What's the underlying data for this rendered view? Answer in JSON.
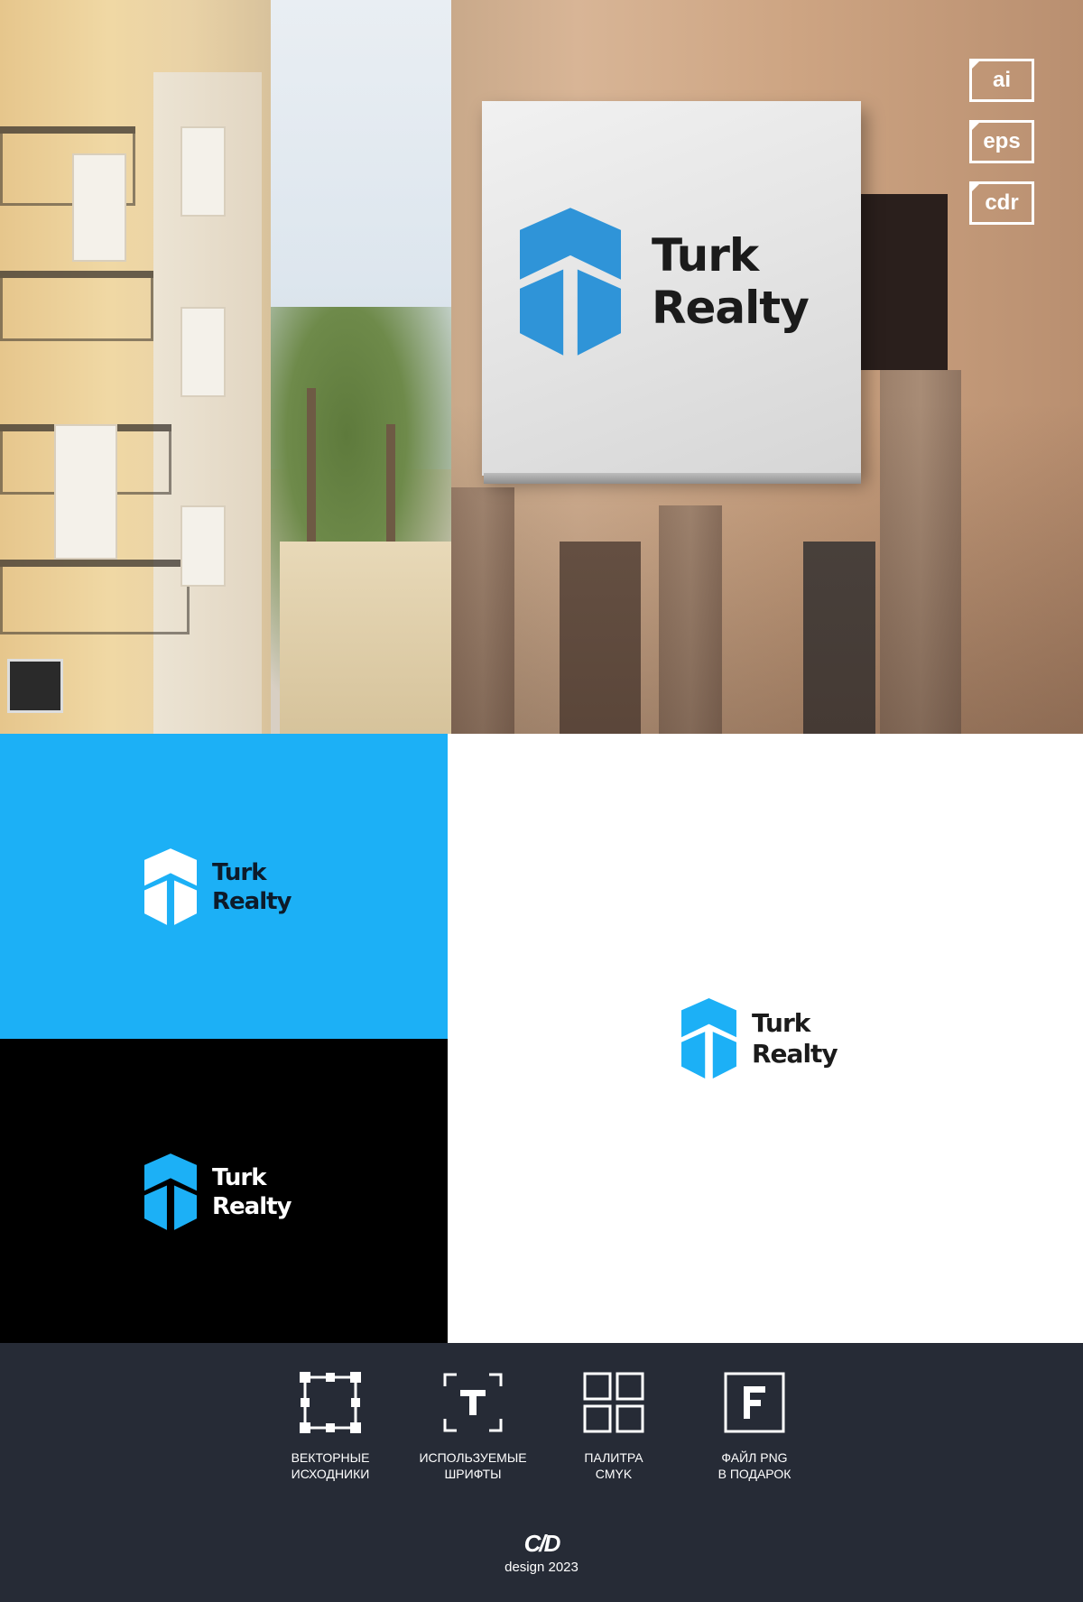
{
  "logo": {
    "line1": "Turk",
    "line2": "Realty",
    "icon": "hexagon-arrow-icon"
  },
  "formats": [
    "ai",
    "eps",
    "cdr"
  ],
  "colors": {
    "brand_blue": "#1cb0f6",
    "sign_icon_blue": "#2f94d8",
    "black": "#000000",
    "white": "#ffffff",
    "footer_bg": "#262b36",
    "text_dark": "#1b1b1b"
  },
  "features": [
    {
      "icon": "vector-selection-icon",
      "line1": "ВЕКТОРНЫЕ",
      "line2": "ИСХОДНИКИ"
    },
    {
      "icon": "font-t-icon",
      "line1": "ИСПОЛЬЗУЕМЫЕ",
      "line2": "ШРИФТЫ"
    },
    {
      "icon": "palette-grid-icon",
      "line1": "ПАЛИТРА",
      "line2": "CMYK"
    },
    {
      "icon": "png-file-f-icon",
      "line1": "ФАЙЛ PNG",
      "line2": "В ПОДАРОК"
    }
  ],
  "brand": {
    "mark": "C/D",
    "caption": "design 2023"
  }
}
